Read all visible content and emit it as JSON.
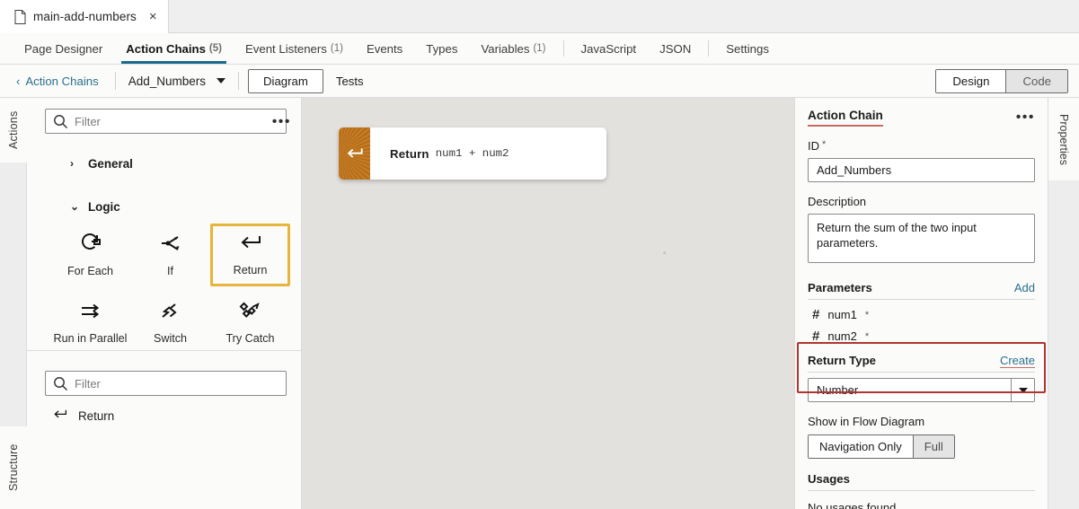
{
  "window": {
    "doc_tab": {
      "label": "main-add-numbers",
      "icon": "file-icon",
      "close": "×"
    }
  },
  "nav_tabs": [
    {
      "label": "Page Designer",
      "count": "",
      "active": false
    },
    {
      "label": "Action Chains",
      "count": "(5)",
      "active": true
    },
    {
      "label": "Event Listeners",
      "count": "(1)",
      "active": false
    },
    {
      "label": "Events",
      "count": "",
      "active": false
    },
    {
      "label": "Types",
      "count": "",
      "active": false
    },
    {
      "label": "Variables",
      "count": "(1)",
      "active": false
    },
    {
      "label": "JavaScript",
      "count": "",
      "active": false
    },
    {
      "label": "JSON",
      "count": "",
      "active": false
    },
    {
      "label": "Settings",
      "count": "",
      "active": false
    }
  ],
  "subbar": {
    "back_label": "Action Chains",
    "chain_name": "Add_Numbers",
    "diagram_button": "Diagram",
    "tests_button": "Tests",
    "design_label": "Design",
    "code_label": "Code"
  },
  "rails": {
    "left_top": "Actions",
    "left_bottom": "Structure",
    "right": "Properties"
  },
  "actions_panel": {
    "filter_placeholder": "Filter",
    "filter_value": "",
    "kebab": "•••",
    "groups": [
      {
        "name": "General",
        "expanded": false,
        "marker": "›"
      },
      {
        "name": "Logic",
        "expanded": true,
        "marker": "⌄"
      }
    ],
    "logic_items": [
      {
        "label": "For Each",
        "icon": "for-each-icon",
        "selected": false
      },
      {
        "label": "If",
        "icon": "if-icon",
        "selected": false
      },
      {
        "label": "Return",
        "icon": "return-icon",
        "selected": true
      },
      {
        "label": "Run in Parallel",
        "icon": "run-in-parallel-icon",
        "selected": false
      },
      {
        "label": "Switch",
        "icon": "switch-icon",
        "selected": false
      },
      {
        "label": "Try Catch",
        "icon": "try-catch-icon",
        "selected": false
      }
    ],
    "lower_filter_placeholder": "Filter",
    "lower_filter_value": "",
    "lower_items": [
      {
        "label": "Return",
        "icon": "return-icon"
      }
    ]
  },
  "canvas": {
    "node": {
      "keyword": "Return",
      "expression": "num1 + num2",
      "icon": "return-icon",
      "icon_color": "#b96d12"
    }
  },
  "properties": {
    "title": "Action Chain",
    "kebab": "•••",
    "id_label": "ID",
    "id_required": "*",
    "id_value": "Add_Numbers",
    "description_label": "Description",
    "description_value": "Return the sum of the two input parameters.",
    "parameters_label": "Parameters",
    "parameters_add": "Add",
    "parameters": [
      {
        "name": "num1",
        "icon": "hash-icon",
        "required": "*"
      },
      {
        "name": "num2",
        "icon": "hash-icon",
        "required": "*"
      }
    ],
    "return_type_label": "Return Type",
    "return_type_create": "Create",
    "return_type_value": "Number",
    "show_in_flow_label": "Show in Flow Diagram",
    "show_in_flow_options": [
      {
        "label": "Navigation Only",
        "selected": true
      },
      {
        "label": "Full",
        "selected": false
      }
    ],
    "usages_label": "Usages",
    "usages_value": "No usages found"
  },
  "colors": {
    "accent_tab": "#1b6b8c",
    "selection_gold": "#e7b43c",
    "annotation_red": "#b0352f",
    "title_underline": "#c96b62",
    "node_icon": "#b96d12",
    "canvas_bg": "#e3e1de",
    "link": "#2a6f8e"
  }
}
